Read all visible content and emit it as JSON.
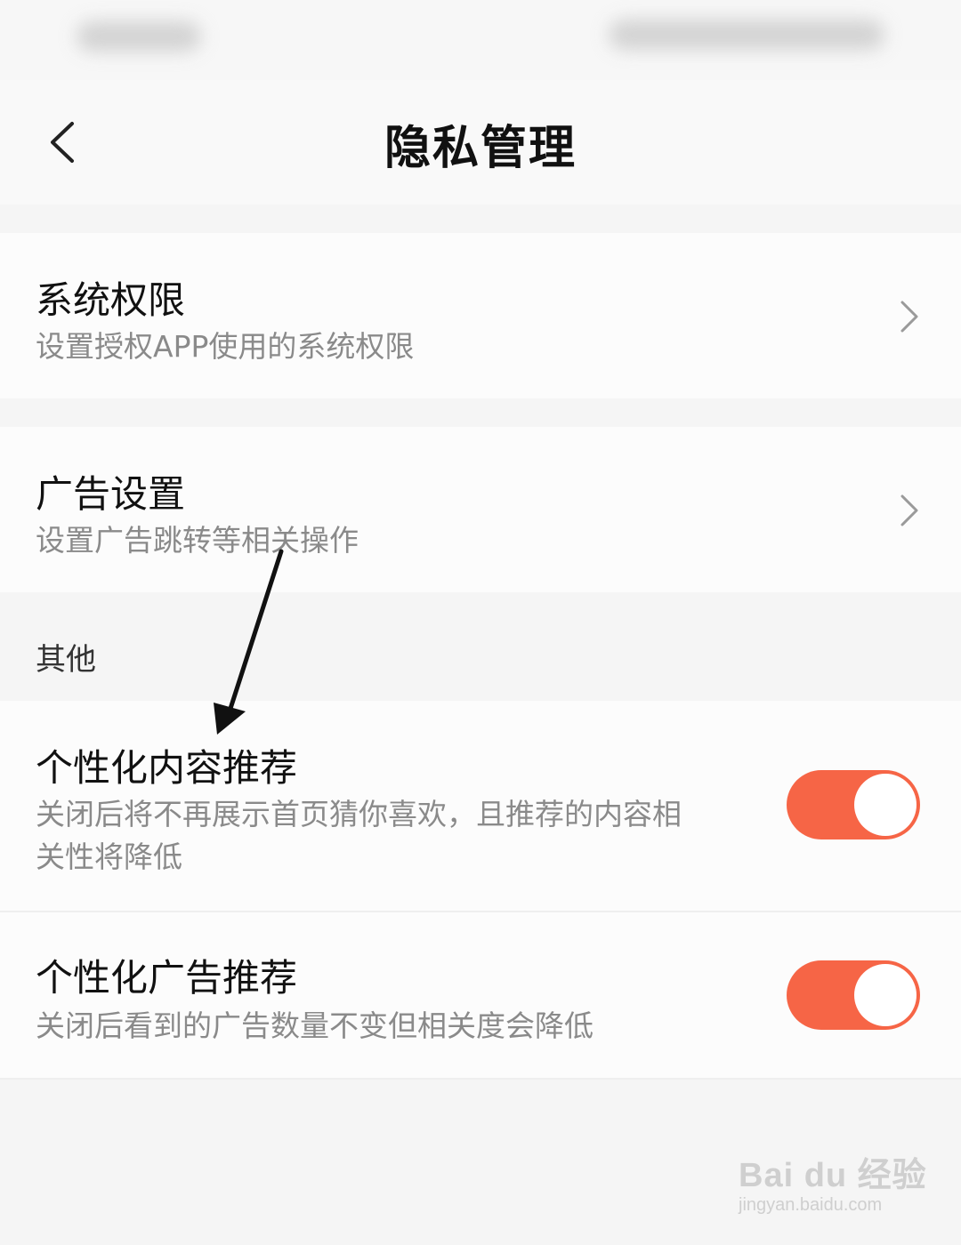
{
  "header": {
    "title": "隐私管理"
  },
  "sections": {
    "system_permissions": {
      "title": "系统权限",
      "subtitle": "设置授权APP使用的系统权限"
    },
    "ad_settings": {
      "title": "广告设置",
      "subtitle": "设置广告跳转等相关操作"
    }
  },
  "group": {
    "label": "其他"
  },
  "toggles": {
    "personalized_content": {
      "title": "个性化内容推荐",
      "subtitle_line1": "关闭后将不再展示首页猜你喜欢，且推荐的内容相",
      "subtitle_line2": "关性将降低",
      "state": "on"
    },
    "personalized_ads": {
      "title": "个性化广告推荐",
      "subtitle": "关闭后看到的广告数量不变但相关度会降低",
      "state": "on"
    }
  },
  "colors": {
    "toggle_on": "#f66546",
    "background": "#f5f5f5"
  },
  "watermark": {
    "main": "Bai du 经验",
    "sub": "jingyan.baidu.com"
  }
}
